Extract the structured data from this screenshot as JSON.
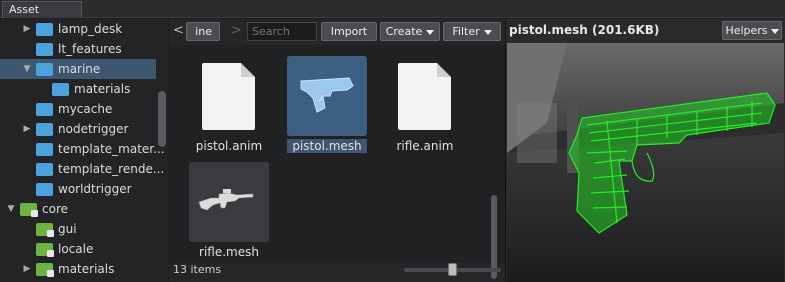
{
  "panel_tab": "Asset Browser",
  "tree": {
    "items": [
      {
        "label": "lamp_desk",
        "color": "blue",
        "arrow": "right",
        "indent": 1
      },
      {
        "label": "lt_features",
        "color": "blue",
        "arrow": "",
        "indent": 1
      },
      {
        "label": "marine",
        "color": "blue",
        "arrow": "down",
        "indent": 1,
        "selected": true
      },
      {
        "label": "materials",
        "color": "blue",
        "arrow": "",
        "indent": 2
      },
      {
        "label": "mycache",
        "color": "blue",
        "arrow": "",
        "indent": 1
      },
      {
        "label": "nodetrigger",
        "color": "blue",
        "arrow": "right",
        "indent": 1
      },
      {
        "label": "template_mater...",
        "color": "blue",
        "arrow": "",
        "indent": 1
      },
      {
        "label": "template_rende...",
        "color": "blue",
        "arrow": "",
        "indent": 1
      },
      {
        "label": "worldtrigger",
        "color": "blue",
        "arrow": "",
        "indent": 1
      },
      {
        "label": "core",
        "color": "green",
        "arrow": "down",
        "indent": 0,
        "locked": true
      },
      {
        "label": "gui",
        "color": "green",
        "arrow": "",
        "indent": 1,
        "locked": true
      },
      {
        "label": "locale",
        "color": "green",
        "arrow": "",
        "indent": 1,
        "locked": true
      },
      {
        "label": "materials",
        "color": "green",
        "arrow": "right",
        "indent": 1,
        "locked": true
      }
    ]
  },
  "toolbar": {
    "back_icon": "chevron-left-icon",
    "back_glyph": "<",
    "breadcrumb": "ine",
    "forward_glyph": ">",
    "search_placeholder": "Search",
    "import_label": "Import",
    "create_label": "Create",
    "filter_label": "Filter"
  },
  "assets": [
    {
      "name": "pistol.anim",
      "kind": "document-icon",
      "selected": false
    },
    {
      "name": "pistol.mesh",
      "kind": "pistol-mesh-icon",
      "selected": true
    },
    {
      "name": "rifle.anim",
      "kind": "document-icon",
      "selected": false
    },
    {
      "name": "rifle.mesh",
      "kind": "rifle-mesh-icon",
      "selected": false
    }
  ],
  "status": {
    "item_count": "13 items",
    "zoom_level": 0.5
  },
  "preview": {
    "title": "pistol.mesh (201.6KB)",
    "helpers_label": "Helpers",
    "wireframe_color": "#22ee22",
    "mesh_color": "#9cc7ee"
  },
  "colors": {
    "selection": "#3d5770",
    "folder_blue": "#4aa3dd",
    "folder_green": "#6db33f"
  }
}
